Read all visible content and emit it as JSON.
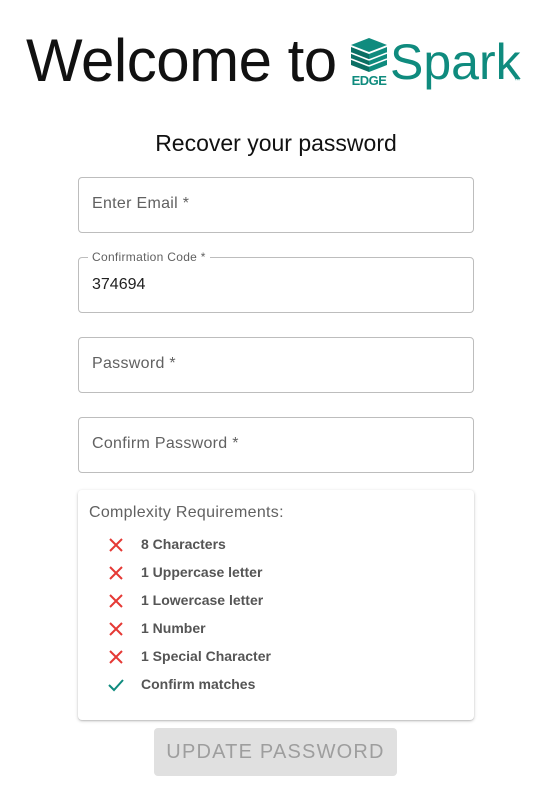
{
  "header": {
    "welcome_text": "Welcome to",
    "brand_badge_text": "EDGE",
    "brand_name": "Spark",
    "brand_tm": "™",
    "brand_color": "#0f8b7e"
  },
  "form": {
    "title": "Recover your password",
    "email": {
      "placeholder": "Enter Email *"
    },
    "confirmation_code": {
      "label": "Confirmation Code *",
      "value": "374694"
    },
    "password": {
      "placeholder": "Password *"
    },
    "confirm_password": {
      "placeholder": "Confirm Password *"
    }
  },
  "complexity": {
    "title": "Complexity Requirements:",
    "items": [
      {
        "label": "8 Characters",
        "status": "fail",
        "icon": "close-icon"
      },
      {
        "label": "1 Uppercase letter",
        "status": "fail",
        "icon": "close-icon"
      },
      {
        "label": "1 Lowercase letter",
        "status": "fail",
        "icon": "close-icon"
      },
      {
        "label": "1 Number",
        "status": "fail",
        "icon": "close-icon"
      },
      {
        "label": "1 Special Character",
        "status": "fail",
        "icon": "close-icon"
      },
      {
        "label": "Confirm matches",
        "status": "pass",
        "icon": "check-icon"
      }
    ],
    "fail_color": "#e53935",
    "pass_color": "#0f8b7e"
  },
  "actions": {
    "update_label": "UPDATE PASSWORD"
  }
}
